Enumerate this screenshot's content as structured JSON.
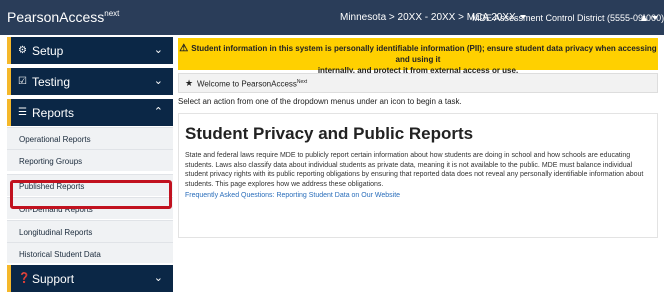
{
  "header": {
    "brand": "PearsonAccess",
    "brand_sup": "next",
    "context": "Minnesota > 20XX - 20XX > MCA 20XX",
    "district": "MDE Assessment Control District (5555-09-000)",
    "user_icon": "user-icon"
  },
  "sidebar": {
    "sections": [
      {
        "label": "Setup",
        "icon": "gear-icon",
        "chevron": "chevron-down"
      },
      {
        "label": "Testing",
        "icon": "checkbox-icon",
        "chevron": "chevron-down"
      },
      {
        "label": "Reports",
        "icon": "list-icon",
        "chevron": "chevron-up"
      },
      {
        "label": "Support",
        "icon": "help-icon",
        "chevron": "chevron-down"
      }
    ],
    "report_items": [
      {
        "label": "Operational Reports"
      },
      {
        "label": "Reporting Groups"
      },
      {
        "label": "Published Reports"
      },
      {
        "label": "On-Demand Reports"
      },
      {
        "label": "Longitudinal Reports"
      },
      {
        "label": "Historical Student Data"
      }
    ]
  },
  "alert": {
    "line1": "Student information in this system is personally identifiable information (PII); ensure student data privacy when accessing and using it",
    "line2": "internally, and protect it from external access or use."
  },
  "welcome": {
    "text": "Welcome to PearsonAccess",
    "sup": "Next"
  },
  "task_text": "Select an action from one of the dropdown menus under an icon to begin a task.",
  "article": {
    "title": "Student Privacy and Public Reports",
    "body": "State and federal laws require MDE to publicly report certain information about how students are doing in school and how schools are educating students. Laws also classify data about individual students as private data, meaning it is not available to the public. MDE must balance individual student privacy rights with its public reporting obligations by ensuring that reported data does not reveal any personally identifiable information about students. This page explores how we address these obligations.",
    "link": "Frequently Asked Questions: Reporting Student Data on Our Website"
  },
  "colors": {
    "topbar": "#2a3d59",
    "sidebar_section": "#0b2746",
    "accent": "#f5b82a",
    "alert": "#ffd000",
    "highlight": "#c1121f",
    "link": "#2a6ebb"
  }
}
